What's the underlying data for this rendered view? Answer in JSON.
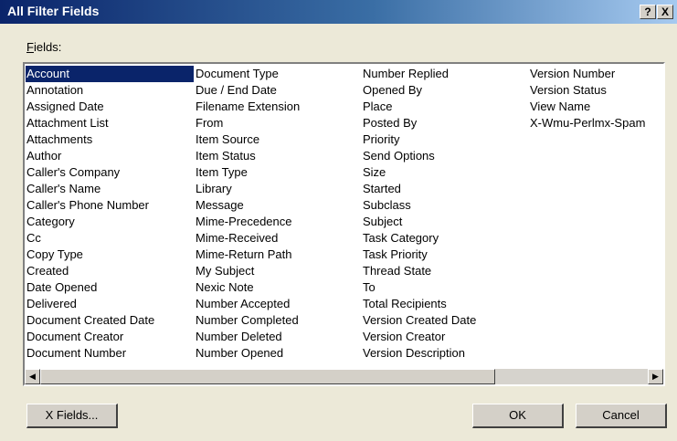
{
  "window": {
    "title": "All Filter Fields",
    "help_label": "?",
    "close_label": "X"
  },
  "fields": {
    "label": "ields:",
    "label_mnemonic": "F",
    "selected": "Account",
    "columns": [
      [
        "Account",
        "Annotation",
        "Assigned Date",
        "Attachment List",
        "Attachments",
        "Author",
        "Caller's Company",
        "Caller's Name",
        "Caller's Phone Number",
        "Category",
        "Cc",
        "Copy Type",
        "Created",
        "Date Opened",
        "Delivered",
        "Document Created Date",
        "Document Creator",
        "Document Number"
      ],
      [
        "Document Type",
        "Due / End Date",
        "Filename Extension",
        "From",
        "Item Source",
        "Item Status",
        "Item Type",
        "Library",
        "Message",
        "Mime-Precedence",
        "Mime-Received",
        "Mime-Return Path",
        "My Subject",
        "Nexic Note",
        "Number Accepted",
        "Number Completed",
        "Number Deleted",
        "Number Opened"
      ],
      [
        "Number Replied",
        "Opened By",
        "Place",
        "Posted By",
        "Priority",
        "Send Options",
        "Size",
        "Started",
        "Subclass",
        "Subject",
        "Task Category",
        "Task Priority",
        "Thread State",
        "To",
        "Total Recipients",
        "Version Created Date",
        "Version Creator",
        "Version Description"
      ],
      [
        "Version Number",
        "Version Status",
        "View Name",
        "X-Wmu-Perlmx-Spam"
      ]
    ]
  },
  "scrollbar": {
    "left_arrow": "◀",
    "right_arrow": "▶"
  },
  "buttons": {
    "xfields": "X Fields...",
    "ok": "OK",
    "cancel": "Cancel"
  }
}
